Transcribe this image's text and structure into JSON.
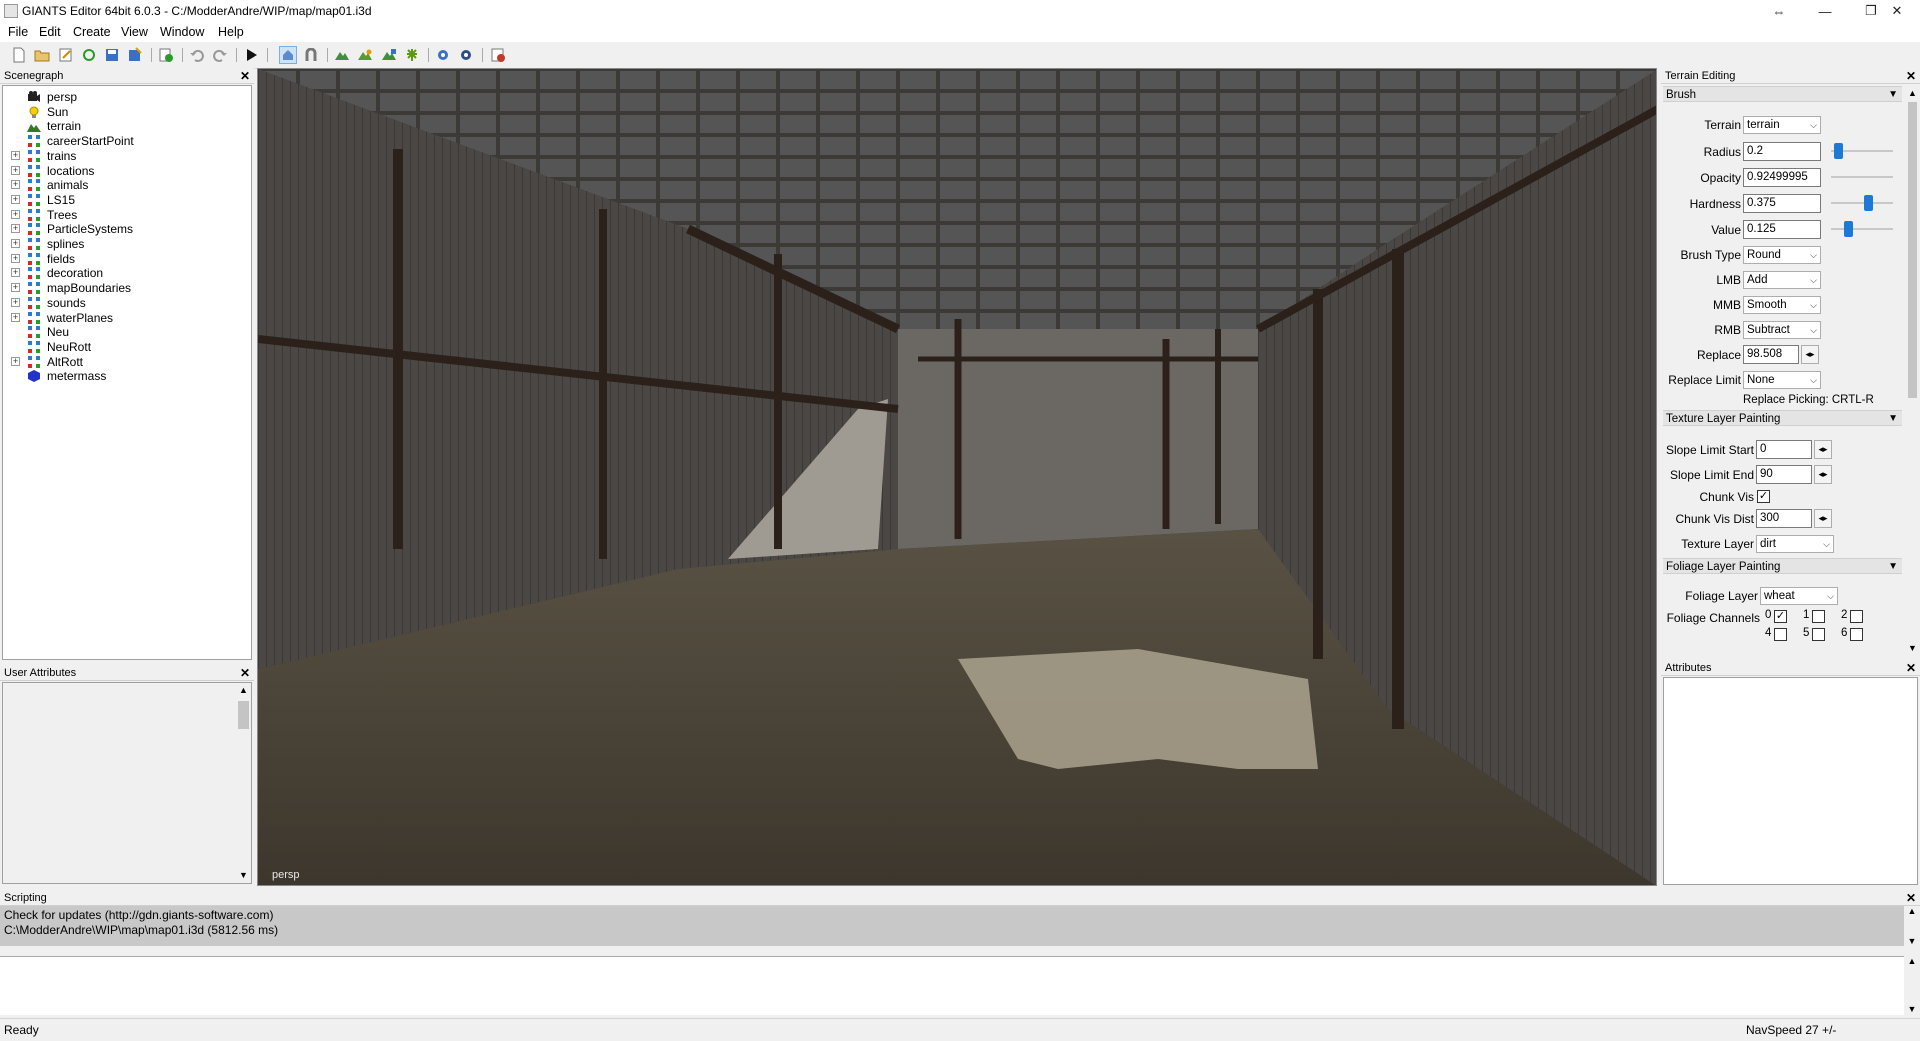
{
  "window": {
    "title": "GIANTS Editor 64bit 6.0.3 - C:/ModderAndre/WIP/map/map01.i3d",
    "controls": [
      "⇔",
      "—",
      "❐",
      "✕"
    ]
  },
  "menu": [
    "File",
    "Edit",
    "Create",
    "View",
    "Window",
    "Help"
  ],
  "scenegraph": {
    "title": "Scenegraph",
    "nodes": [
      {
        "label": "persp",
        "icon": "camera-icon",
        "expandable": false
      },
      {
        "label": "Sun",
        "icon": "light-icon",
        "expandable": false
      },
      {
        "label": "terrain",
        "icon": "terrain-icon",
        "expandable": false
      },
      {
        "label": "careerStartPoint",
        "icon": "transformgroup-icon",
        "expandable": false
      },
      {
        "label": "trains",
        "icon": "transformgroup-icon",
        "expandable": true
      },
      {
        "label": "locations",
        "icon": "transformgroup-icon",
        "expandable": true
      },
      {
        "label": "animals",
        "icon": "transformgroup-icon",
        "expandable": true
      },
      {
        "label": "LS15",
        "icon": "transformgroup-icon",
        "expandable": true
      },
      {
        "label": "Trees",
        "icon": "transformgroup-icon",
        "expandable": true
      },
      {
        "label": "ParticleSystems",
        "icon": "transformgroup-icon",
        "expandable": true
      },
      {
        "label": "splines",
        "icon": "transformgroup-icon",
        "expandable": true
      },
      {
        "label": "fields",
        "icon": "transformgroup-icon",
        "expandable": true
      },
      {
        "label": "decoration",
        "icon": "transformgroup-icon",
        "expandable": true
      },
      {
        "label": "mapBoundaries",
        "icon": "transformgroup-icon",
        "expandable": true
      },
      {
        "label": "sounds",
        "icon": "transformgroup-icon",
        "expandable": true
      },
      {
        "label": "waterPlanes",
        "icon": "transformgroup-icon",
        "expandable": true
      },
      {
        "label": "Neu",
        "icon": "transformgroup-icon",
        "expandable": false
      },
      {
        "label": "NeuRott",
        "icon": "transformgroup-icon",
        "expandable": false
      },
      {
        "label": "AltRott",
        "icon": "transformgroup-icon",
        "expandable": true
      },
      {
        "label": "metermass",
        "icon": "shape-icon",
        "expandable": false
      }
    ]
  },
  "user_attributes": {
    "title": "User Attributes"
  },
  "viewport": {
    "camera_label": "persp"
  },
  "terrain_editing": {
    "title": "Terrain Editing",
    "brush": {
      "title": "Brush",
      "terrain_label": "Terrain",
      "terrain_value": "terrain",
      "radius_label": "Radius",
      "radius_value": "0.2",
      "radius_level": 0.05,
      "opacity_label": "Opacity",
      "opacity_value": "0.92499995",
      "hardness_label": "Hardness",
      "hardness_value": "0.375",
      "hardness_level": 0.62,
      "value_label": "Value",
      "value_value": "0.125",
      "value_level": 0.25,
      "brush_type_label": "Brush Type",
      "brush_type_value": "Round",
      "lmb_label": "LMB",
      "lmb_value": "Add",
      "mmb_label": "MMB",
      "mmb_value": "Smooth",
      "rmb_label": "RMB",
      "rmb_value": "Subtract",
      "replace_label": "Replace",
      "replace_value": "98.508",
      "replace_limit_label": "Replace Limit",
      "replace_limit_value": "None",
      "replace_picking": "Replace Picking: CRTL-R"
    },
    "texture": {
      "title": "Texture Layer Painting",
      "slope_start_label": "Slope Limit Start",
      "slope_start_value": "0",
      "slope_end_label": "Slope Limit End",
      "slope_end_value": "90",
      "chunk_vis_label": "Chunk Vis",
      "chunk_vis_checked": true,
      "chunk_vis_dist_label": "Chunk Vis Dist",
      "chunk_vis_dist_value": "300",
      "texture_layer_label": "Texture Layer",
      "texture_layer_value": "dirt"
    },
    "foliage": {
      "title": "Foliage Layer Painting",
      "foliage_layer_label": "Foliage Layer",
      "foliage_layer_value": "wheat",
      "foliage_channels_label": "Foliage Channels",
      "channels": [
        {
          "n": "0",
          "checked": true
        },
        {
          "n": "1",
          "checked": false
        },
        {
          "n": "2",
          "checked": false
        },
        {
          "n": "4",
          "checked": false
        },
        {
          "n": "5",
          "checked": false
        },
        {
          "n": "6",
          "checked": false
        }
      ]
    }
  },
  "attributes": {
    "title": "Attributes"
  },
  "scripting": {
    "title": "Scripting",
    "lines": [
      "Check for updates (http://gdn.giants-software.com)",
      "C:\\ModderAndre\\WIP\\map\\map01.i3d (5812.56 ms)"
    ]
  },
  "status": {
    "left": "Ready",
    "right": "NavSpeed 27 +/-"
  }
}
